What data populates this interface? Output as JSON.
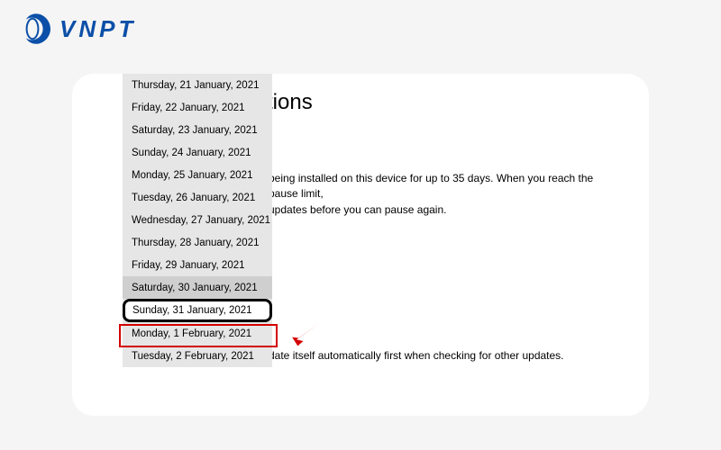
{
  "logo": {
    "text": "VNPT"
  },
  "panel": {
    "heading_fragment": "tions",
    "para1_line1": "being installed on this device for up to 35 days. When you reach the pause limit,",
    "para1_line2": "updates before you can pause again.",
    "para2": "date itself automatically first when checking for other updates."
  },
  "dropdown": {
    "items": [
      {
        "label": "Thursday, 21 January, 2021"
      },
      {
        "label": "Friday, 22 January, 2021"
      },
      {
        "label": "Saturday, 23 January, 2021"
      },
      {
        "label": "Sunday, 24 January, 2021"
      },
      {
        "label": "Monday, 25 January, 2021"
      },
      {
        "label": "Tuesday, 26 January, 2021"
      },
      {
        "label": "Wednesday, 27 January, 2021"
      },
      {
        "label": "Thursday, 28 January, 2021"
      },
      {
        "label": "Friday, 29 January, 2021"
      },
      {
        "label": "Saturday, 30 January, 2021"
      },
      {
        "label": "Sunday, 31 January, 2021"
      },
      {
        "label": "Monday, 1 February, 2021"
      },
      {
        "label": "Tuesday, 2 February, 2021"
      }
    ],
    "hover_index": 9,
    "selected_index": 10
  }
}
